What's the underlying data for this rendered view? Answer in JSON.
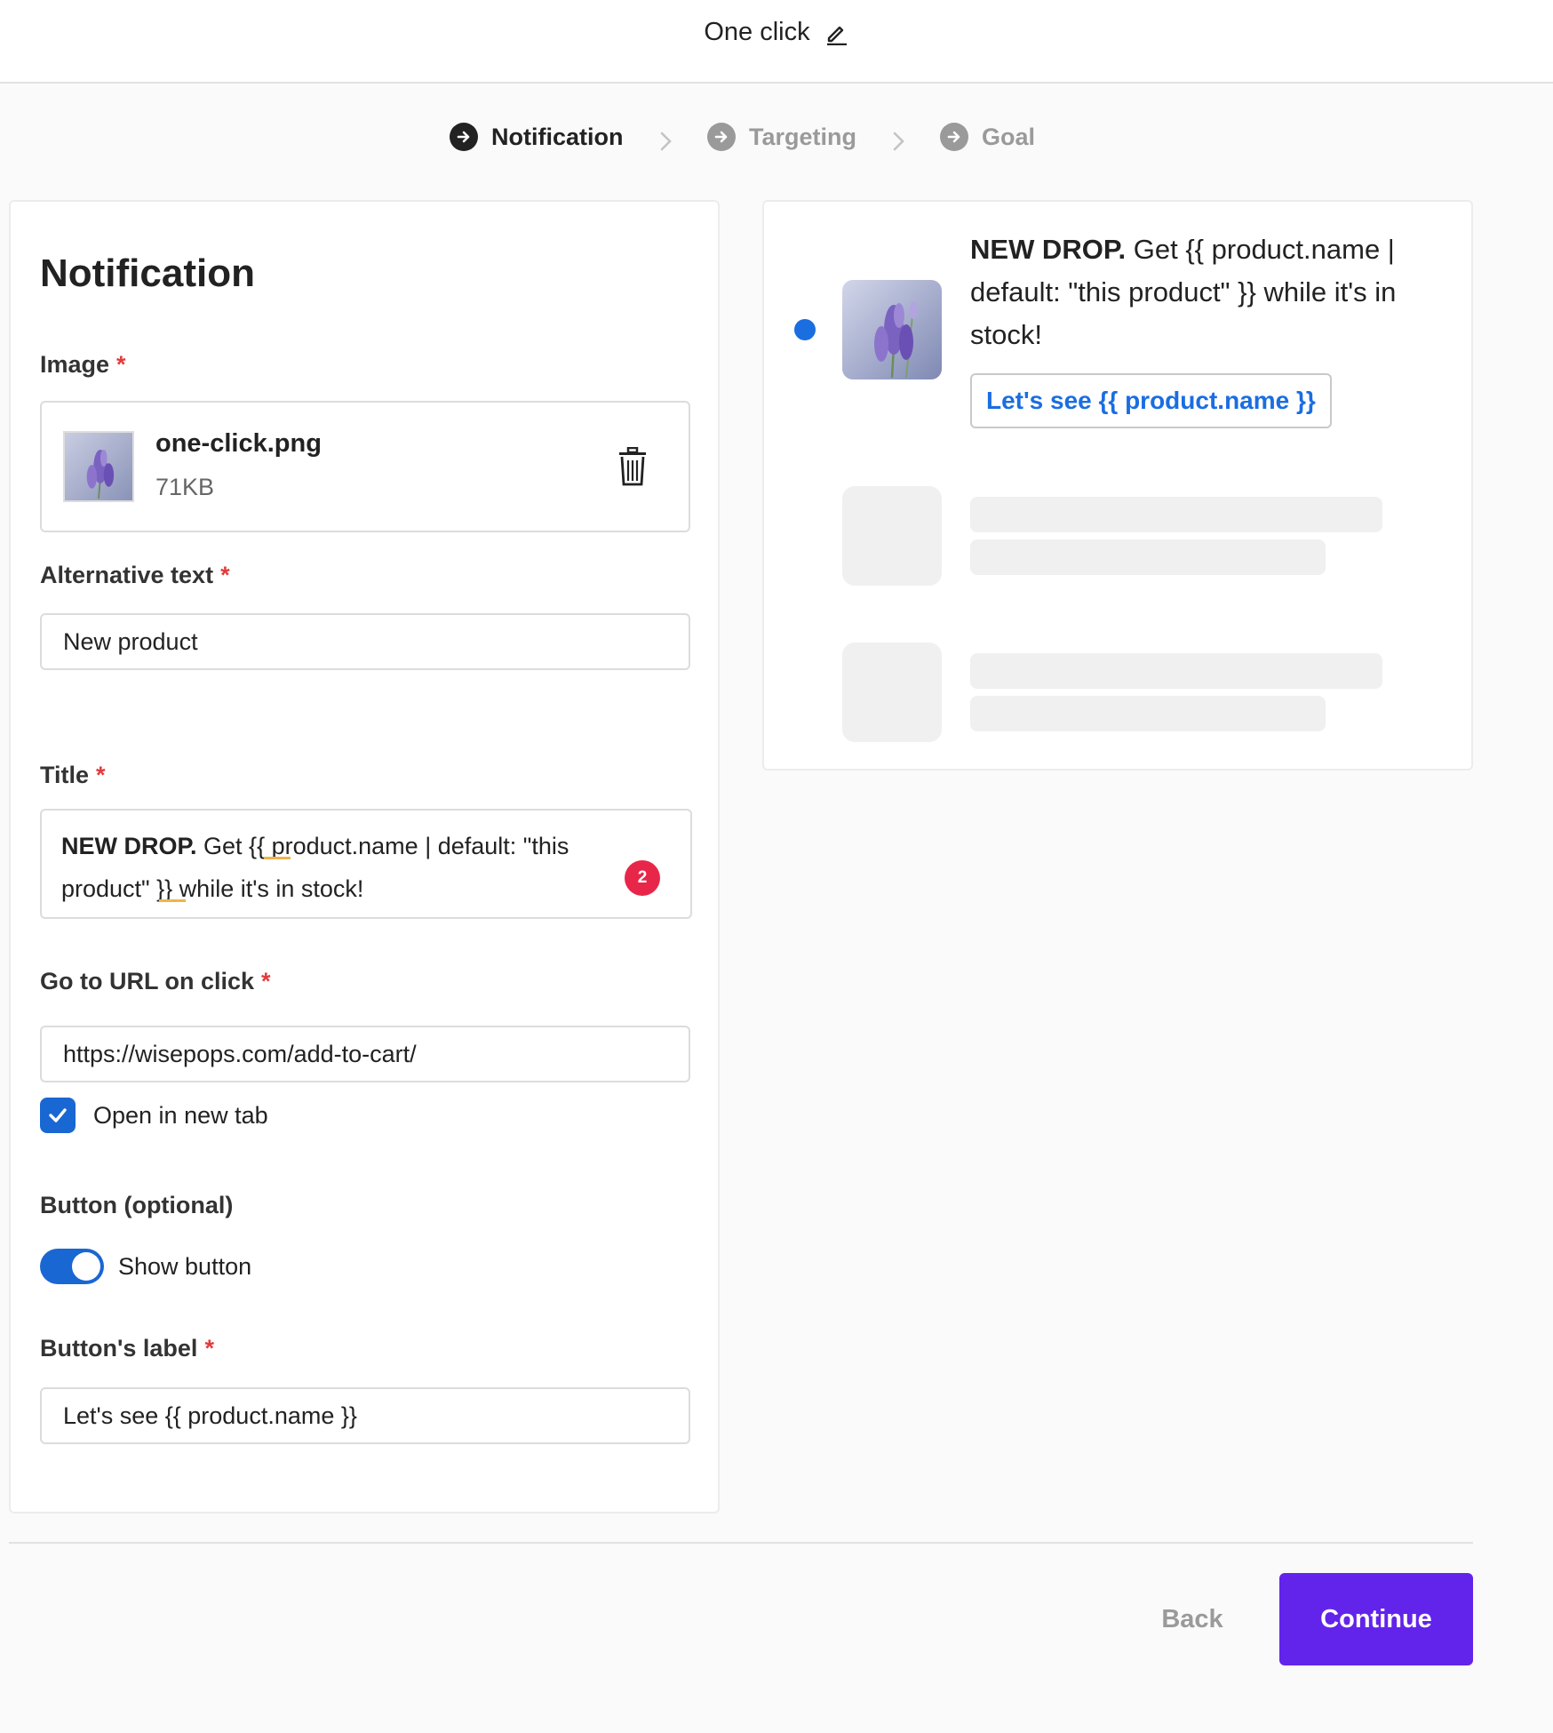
{
  "header": {
    "title": "One click"
  },
  "stepper": {
    "steps": [
      {
        "label": "Notification",
        "state": "active"
      },
      {
        "label": "Targeting",
        "state": "inactive"
      },
      {
        "label": "Goal",
        "state": "inactive"
      }
    ]
  },
  "form": {
    "heading": "Notification",
    "image": {
      "label": "Image",
      "required_mark": "*",
      "file_name": "one-click.png",
      "file_size": "71KB"
    },
    "alt_text": {
      "label": "Alternative text",
      "required_mark": "*",
      "value": "New product"
    },
    "title": {
      "label": "Title",
      "required_mark": "*",
      "bold_part": "NEW DROP.",
      "rest": " Get {{ product.name | default: \"this product\" }} while it's in stock!",
      "badge_count": "2"
    },
    "url": {
      "label": "Go to URL on click",
      "required_mark": "*",
      "value": "https://wisepops.com/add-to-cart/",
      "open_new_tab_label": "Open in new tab",
      "open_new_tab_checked": true
    },
    "button": {
      "label": "Button (optional)",
      "show_button_label": "Show button",
      "show_button_on": true
    },
    "button_label": {
      "label": "Button's label",
      "required_mark": "*",
      "value": "Let's see {{ product.name }}"
    }
  },
  "preview": {
    "title_bold": "NEW DROP.",
    "title_rest": " Get {{ product.name | default: \"this product\" }} while it's in stock!",
    "button_text": "Let's see {{ product.name }}"
  },
  "footer": {
    "back_label": "Back",
    "continue_label": "Continue"
  },
  "colors": {
    "accent": "#6224ea",
    "primary_blue": "#1967d2",
    "required": "#e23b3b",
    "badge": "#e8264a"
  }
}
